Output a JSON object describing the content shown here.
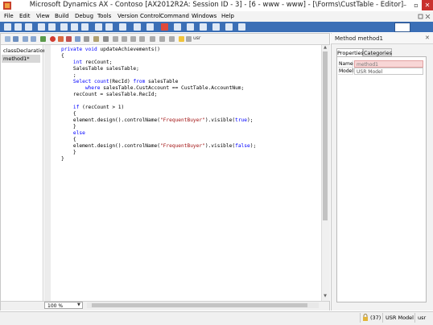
{
  "window": {
    "title": "Microsoft Dynamics AX - Contoso [AX2012R2A: Session ID - 3] - [6 - www - www] - [\\Forms\\CustTable - Editor]",
    "minimize_glyph": "–",
    "maximize_glyph": "▫",
    "close_glyph": "✕"
  },
  "menu": {
    "items": [
      "File",
      "Edit",
      "View",
      "Build",
      "Debug",
      "Tools",
      "Version Control",
      "Command",
      "Windows",
      "Help"
    ]
  },
  "editor": {
    "toolbar_label": "usr",
    "methods": [
      "classDeclaration",
      "method1*"
    ],
    "selected_method": "method1*",
    "code_lines": [
      "private void updateAchievements()",
      "{",
      "    int recCount;",
      "    SalesTable salesTable;",
      "    ;",
      "    Select count(RecId) from salesTable",
      "        where salesTable.CustAccount == CustTable.AccountNum;",
      "    recCount = salesTable.RecId;",
      "",
      "    if (recCount > 1)",
      "    {",
      "    element.design().controlName(\"FrequentBuyer\").visible(true);",
      "    }",
      "    else",
      "    {",
      "    element.design().controlName(\"FrequentBuyer\").visible(false);",
      "    }",
      "}"
    ],
    "zoom": "100 %"
  },
  "properties_panel": {
    "title": "Method method1",
    "close_glyph": "✕",
    "tabs": [
      "Properties",
      "Categories"
    ],
    "active_tab": "Properties",
    "rows": [
      {
        "name": "Name",
        "value": "method1"
      },
      {
        "name": "Model",
        "value": "USR Model"
      }
    ]
  },
  "statusbar": {
    "count": "(37)",
    "model": "USR Model",
    "user": "usr"
  },
  "colors": {
    "toolbar_blue": "#3b6fb6",
    "close_red": "#c9312e",
    "keyword_blue": "#0000ff",
    "string_red": "#a31515",
    "invalid_name_bg": "#f8d6d6"
  }
}
